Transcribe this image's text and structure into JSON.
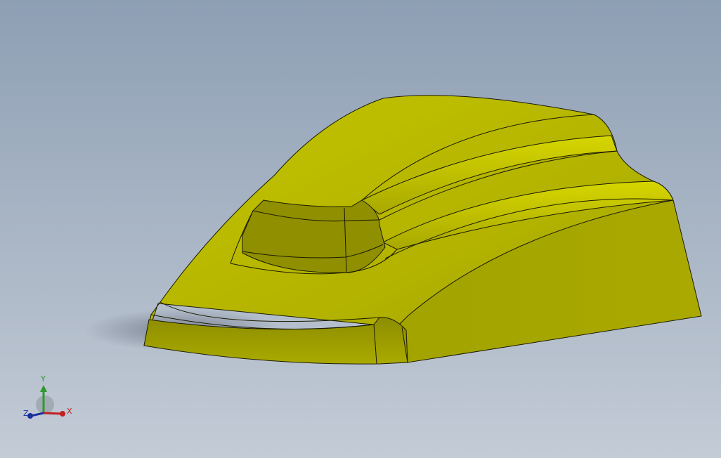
{
  "viewport": {
    "background_top": "#8d9fb4",
    "background_bottom": "#c3cbd6"
  },
  "model": {
    "color": "#b5b500",
    "edge_color": "#1a1a00"
  },
  "triad": {
    "x_label": "X",
    "y_label": "Y",
    "z_label": "Z",
    "x_color": "#c02020",
    "y_color": "#2e9a2e",
    "z_color": "#1a2fa0"
  }
}
